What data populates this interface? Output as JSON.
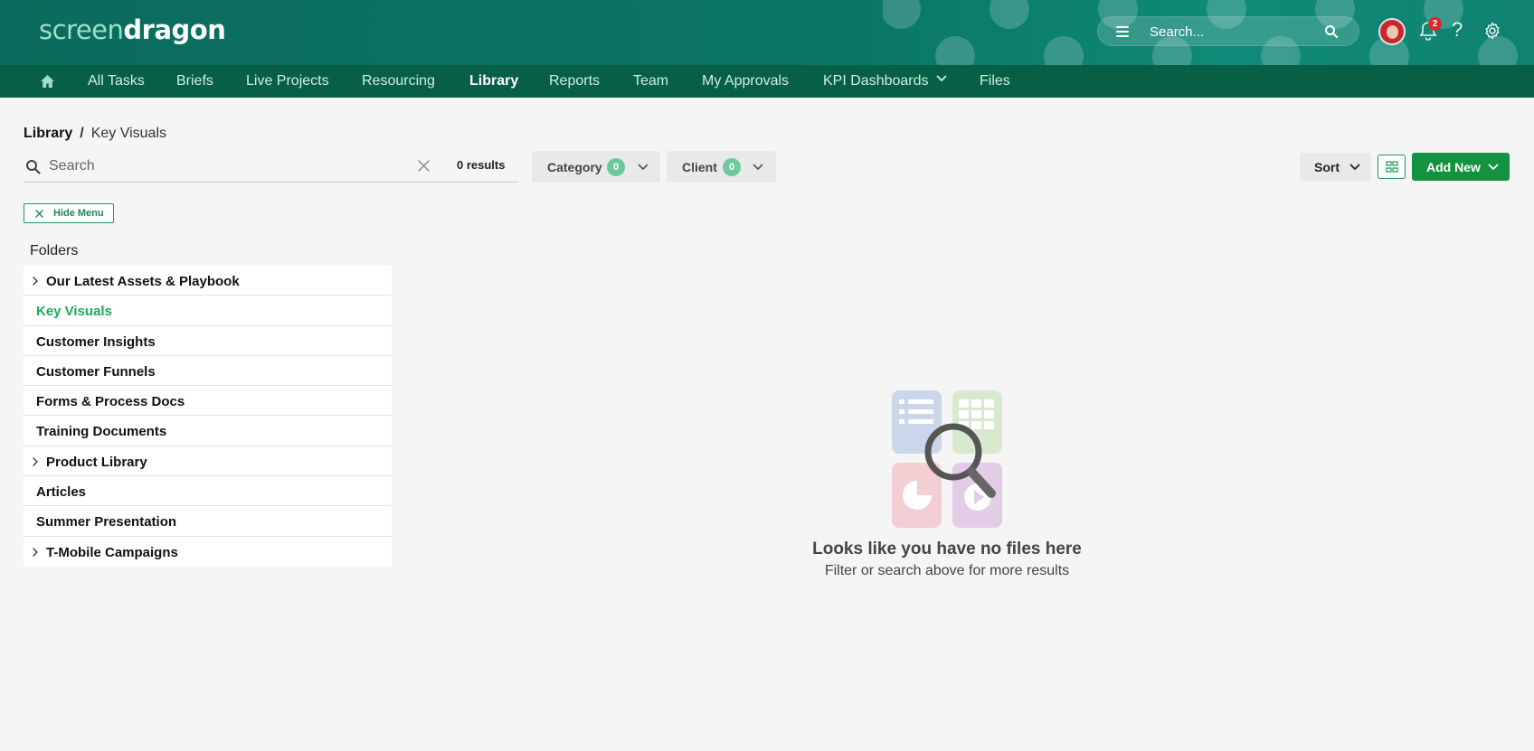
{
  "header": {
    "logo_part1": "screen",
    "logo_part2": "dragon",
    "search_placeholder": "Search...",
    "notification_count": "2",
    "help_glyph": "?"
  },
  "nav": {
    "items": [
      {
        "label": "All Tasks"
      },
      {
        "label": "Briefs"
      },
      {
        "label": "Live Projects"
      },
      {
        "label": "Resourcing"
      },
      {
        "label": "Library",
        "active": true
      },
      {
        "label": "Reports"
      },
      {
        "label": "Team"
      },
      {
        "label": "My Approvals"
      },
      {
        "label": "KPI Dashboards"
      },
      {
        "label": "Files"
      }
    ]
  },
  "breadcrumb": {
    "root": "Library",
    "separator": "/",
    "current": "Key Visuals"
  },
  "toolbar": {
    "search_placeholder": "Search",
    "results": "0 results",
    "category_label": "Category",
    "category_count": "0",
    "client_label": "Client",
    "client_count": "0",
    "sort_label": "Sort",
    "add_new_label": "Add New",
    "hide_menu_label": "Hide Menu"
  },
  "folders": {
    "title": "Folders",
    "items": [
      {
        "label": "Our Latest Assets & Playbook",
        "expandable": true
      },
      {
        "label": "Key Visuals",
        "active": true
      },
      {
        "label": "Customer Insights"
      },
      {
        "label": "Customer Funnels"
      },
      {
        "label": "Forms & Process Docs"
      },
      {
        "label": "Training Documents"
      },
      {
        "label": "Product Library",
        "expandable": true
      },
      {
        "label": "Articles"
      },
      {
        "label": "Summer Presentation"
      },
      {
        "label": "T-Mobile Campaigns",
        "expandable": true
      }
    ]
  },
  "empty_state": {
    "title": "Looks like you have no files here",
    "subtitle": "Filter or search above for more results"
  },
  "colors": {
    "header_bg": "#0a7565",
    "nav_bg": "#075f45",
    "accent_green": "#13923f",
    "active_folder": "#1aaa60"
  }
}
